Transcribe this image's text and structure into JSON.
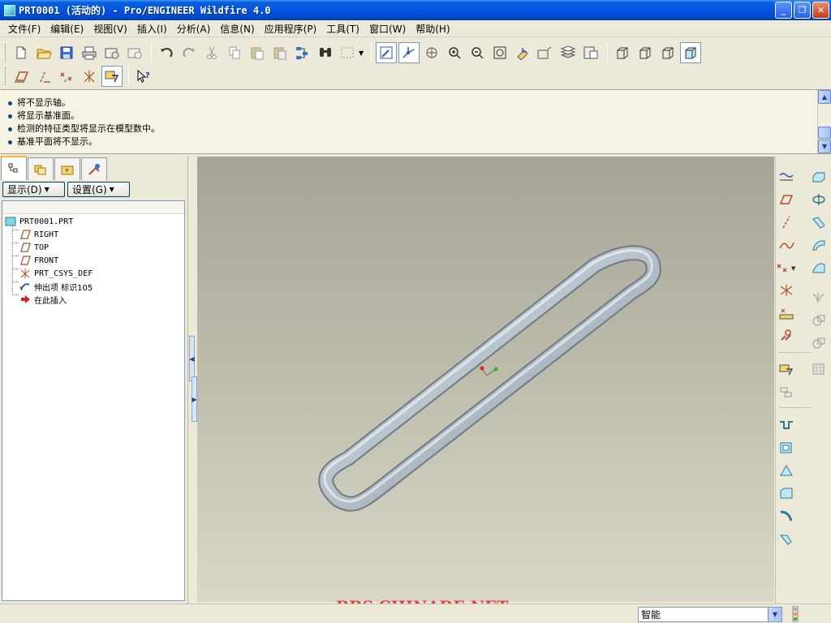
{
  "window": {
    "title": "PRT0001 (活动的) - Pro/ENGINEER Wildfire 4.0",
    "minimize": "_",
    "restore": "❐",
    "close": "✕"
  },
  "menu": {
    "items": [
      "文件(F)",
      "编辑(E)",
      "视图(V)",
      "插入(I)",
      "分析(A)",
      "信息(N)",
      "应用程序(P)",
      "工具(T)",
      "窗口(W)",
      "帮助(H)"
    ]
  },
  "toolbar": {
    "row1_icons": [
      "new-file-icon",
      "open-folder-icon",
      "save-icon",
      "print-icon",
      "send-mail-icon",
      "mail-icon",
      "undo-icon",
      "redo-icon",
      "cut-icon",
      "copy-icon",
      "paste-icon",
      "paste-special-icon",
      "regenerate-icon",
      "find-icon",
      "select-box-icon",
      "repaint-icon",
      "spin-center-icon",
      "orient-mode-icon",
      "zoom-in-icon",
      "zoom-out-icon",
      "refit-icon",
      "reorient-icon",
      "saved-views-icon",
      "layers-icon",
      "view-manager-icon",
      "wireframe-icon",
      "hidden-line-icon",
      "no-hidden-icon",
      "shading-icon"
    ],
    "row2_icons": [
      "plane-display-icon",
      "axis-display-icon",
      "point-display-icon",
      "csys-display-icon",
      "annotation-display-icon",
      "context-help-icon"
    ]
  },
  "messages": [
    "将不显示轴。",
    "将显示基准面。",
    "检测的特征类型将显示在模型数中。",
    "基准平面将不显示。"
  ],
  "navigator": {
    "tabs": [
      "model-tree-tab",
      "folder-browser-tab",
      "favorites-tab",
      "connections-tab"
    ],
    "show_button": "显示(D)",
    "settings_button": "设置(G)",
    "tree": [
      {
        "label": "PRT0001.PRT",
        "icon": "part-icon"
      },
      {
        "label": "RIGHT",
        "icon": "datum-plane-icon"
      },
      {
        "label": "TOP",
        "icon": "datum-plane-icon"
      },
      {
        "label": "FRONT",
        "icon": "datum-plane-icon"
      },
      {
        "label": "PRT_CSYS_DEF",
        "icon": "csys-icon"
      },
      {
        "label": "伸出项 标识105",
        "icon": "sweep-protrusion-icon"
      },
      {
        "label": "在此插入",
        "icon": "insert-here-arrow-icon"
      }
    ]
  },
  "viewport": {
    "watermark": "BBS.CHINADE.NET",
    "model": "swept tube loop (stadium shape)",
    "colors": {
      "bg_top": "#a6a496",
      "bg_bottom": "#d9d7c6",
      "model": "#b7c2cc",
      "watermark": "#e33c3c"
    }
  },
  "right_toolbar": {
    "col1_icons": [
      "sketch-icon",
      "datum-plane-tool-icon",
      "datum-axis-tool-icon",
      "datum-curve-tool-icon",
      "datum-point-tool-icon",
      "csys-tool-icon",
      "analysis-feature-icon",
      "reference-link-icon",
      "annotation-feature-icon",
      "shrinkwrap-icon",
      "extrude-tool-icon",
      "hole-tool-icon",
      "draft-tool-icon",
      "round-tool-icon",
      "chamfer-tool-icon",
      "rib-tool-icon"
    ],
    "col2_icons": [
      "extrude-icon",
      "revolve-icon",
      "variable-sweep-icon",
      "blend-icon",
      "boundary-blend-icon",
      "mirror-icon",
      "merge-icon",
      "trim-icon",
      "pattern-icon"
    ]
  },
  "status": {
    "filter_value": "智能"
  }
}
